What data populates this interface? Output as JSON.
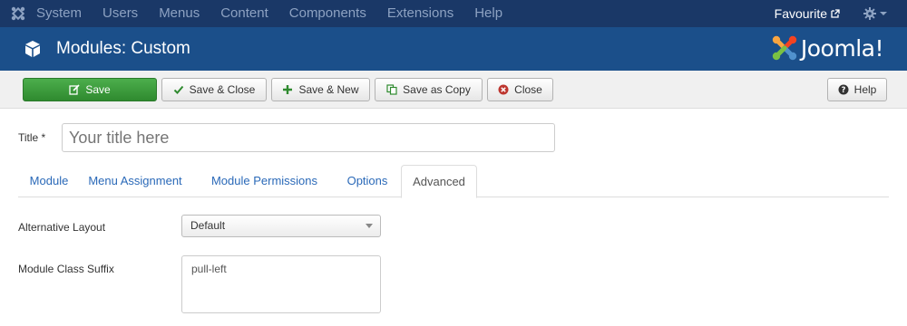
{
  "topnav": {
    "menu": [
      "System",
      "Users",
      "Menus",
      "Content",
      "Components",
      "Extensions",
      "Help"
    ],
    "favourite": "Favourite"
  },
  "header": {
    "title": "Modules: Custom",
    "brand": "Joomla!"
  },
  "toolbar": {
    "save": "Save",
    "save_close": "Save & Close",
    "save_new": "Save & New",
    "save_copy": "Save as Copy",
    "close": "Close",
    "help": "Help"
  },
  "form": {
    "title_label": "Title *",
    "title_placeholder": "Your title here",
    "tabs": [
      "Module",
      "Menu Assignment",
      "Module Permissions",
      "Options",
      "Advanced"
    ],
    "active_tab": "Advanced",
    "layout_label": "Alternative Layout",
    "layout_value": "Default",
    "suffix_label": "Module Class Suffix",
    "suffix_value": "pull-left"
  },
  "colors": {
    "topnav_bg": "#1a3867",
    "header_bg": "#1b4f8a",
    "save_green": "#3d9b3d",
    "link_blue": "#2a69b8"
  }
}
